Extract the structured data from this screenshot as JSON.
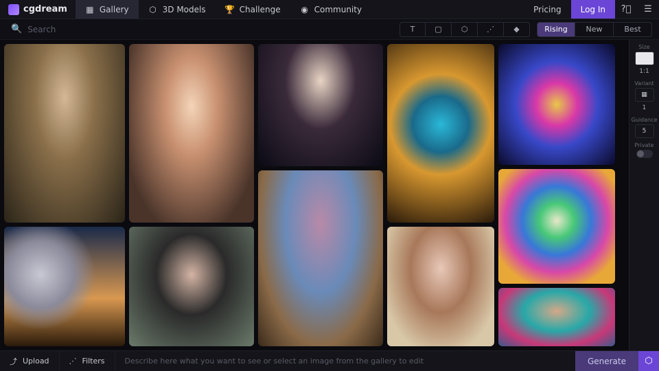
{
  "brand": "cgdream",
  "nav": {
    "gallery": "Gallery",
    "models": "3D Models",
    "challenge": "Challenge",
    "community": "Community"
  },
  "top": {
    "pricing": "Pricing",
    "login": "Log In"
  },
  "search": {
    "placeholder": "Search"
  },
  "sort": {
    "rising": "Rising",
    "new": "New",
    "best": "Best"
  },
  "side": {
    "size_label": "Size",
    "size_value": "1:1",
    "variant_label": "Variant",
    "variant_value": "1",
    "guidance_label": "Guidance",
    "guidance_value": "5",
    "private_label": "Private"
  },
  "bottom": {
    "upload": "Upload",
    "filters": "Filters",
    "prompt_placeholder": "Describe here what you want to see or select an image from the gallery to edit",
    "generate": "Generate"
  },
  "tools": {
    "text": "T",
    "image": "image-icon",
    "cube": "cube-icon",
    "lines": "lines-icon",
    "poly": "poly-icon"
  }
}
